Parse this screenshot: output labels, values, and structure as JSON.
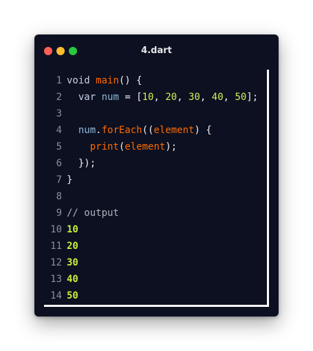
{
  "window": {
    "title": "4.dart",
    "traffic_lights": {
      "close_color": "#ff5f56",
      "minimize_color": "#ffbd2e",
      "maximize_color": "#27c93f"
    }
  },
  "editor": {
    "background": "#0c1021",
    "lines": [
      {
        "n": "1",
        "tokens": [
          [
            "void",
            "kw"
          ],
          [
            " ",
            "p"
          ],
          [
            "main",
            "fn"
          ],
          [
            "() {",
            "p"
          ]
        ]
      },
      {
        "n": "2",
        "tokens": [
          [
            "  ",
            "p"
          ],
          [
            "var",
            "kw"
          ],
          [
            " ",
            "p"
          ],
          [
            "num",
            "var"
          ],
          [
            " = [",
            "p"
          ],
          [
            "10",
            "num"
          ],
          [
            ", ",
            "p"
          ],
          [
            "20",
            "num"
          ],
          [
            ", ",
            "p"
          ],
          [
            "30",
            "num"
          ],
          [
            ", ",
            "p"
          ],
          [
            "40",
            "num"
          ],
          [
            ", ",
            "p"
          ],
          [
            "50",
            "num"
          ],
          [
            "];",
            "p"
          ]
        ]
      },
      {
        "n": "3",
        "tokens": []
      },
      {
        "n": "4",
        "tokens": [
          [
            "  ",
            "p"
          ],
          [
            "num",
            "var"
          ],
          [
            ".",
            "p"
          ],
          [
            "forEach",
            "fn"
          ],
          [
            "((",
            "p"
          ],
          [
            "element",
            "fn"
          ],
          [
            ") {",
            "p"
          ]
        ]
      },
      {
        "n": "5",
        "tokens": [
          [
            "    ",
            "p"
          ],
          [
            "print",
            "fn"
          ],
          [
            "(",
            "p"
          ],
          [
            "element",
            "fn"
          ],
          [
            ");",
            "p"
          ]
        ]
      },
      {
        "n": "6",
        "tokens": [
          [
            "  });",
            "p"
          ]
        ]
      },
      {
        "n": "7",
        "tokens": [
          [
            "}",
            "p"
          ]
        ]
      },
      {
        "n": "8",
        "tokens": []
      },
      {
        "n": "9",
        "tokens": [
          [
            "// output",
            "com"
          ]
        ]
      },
      {
        "n": "10",
        "tokens": [
          [
            "10",
            "out"
          ]
        ]
      },
      {
        "n": "11",
        "tokens": [
          [
            "20",
            "out"
          ]
        ]
      },
      {
        "n": "12",
        "tokens": [
          [
            "30",
            "out"
          ]
        ]
      },
      {
        "n": "13",
        "tokens": [
          [
            "40",
            "out"
          ]
        ]
      },
      {
        "n": "14",
        "tokens": [
          [
            "50",
            "out"
          ]
        ]
      }
    ]
  }
}
